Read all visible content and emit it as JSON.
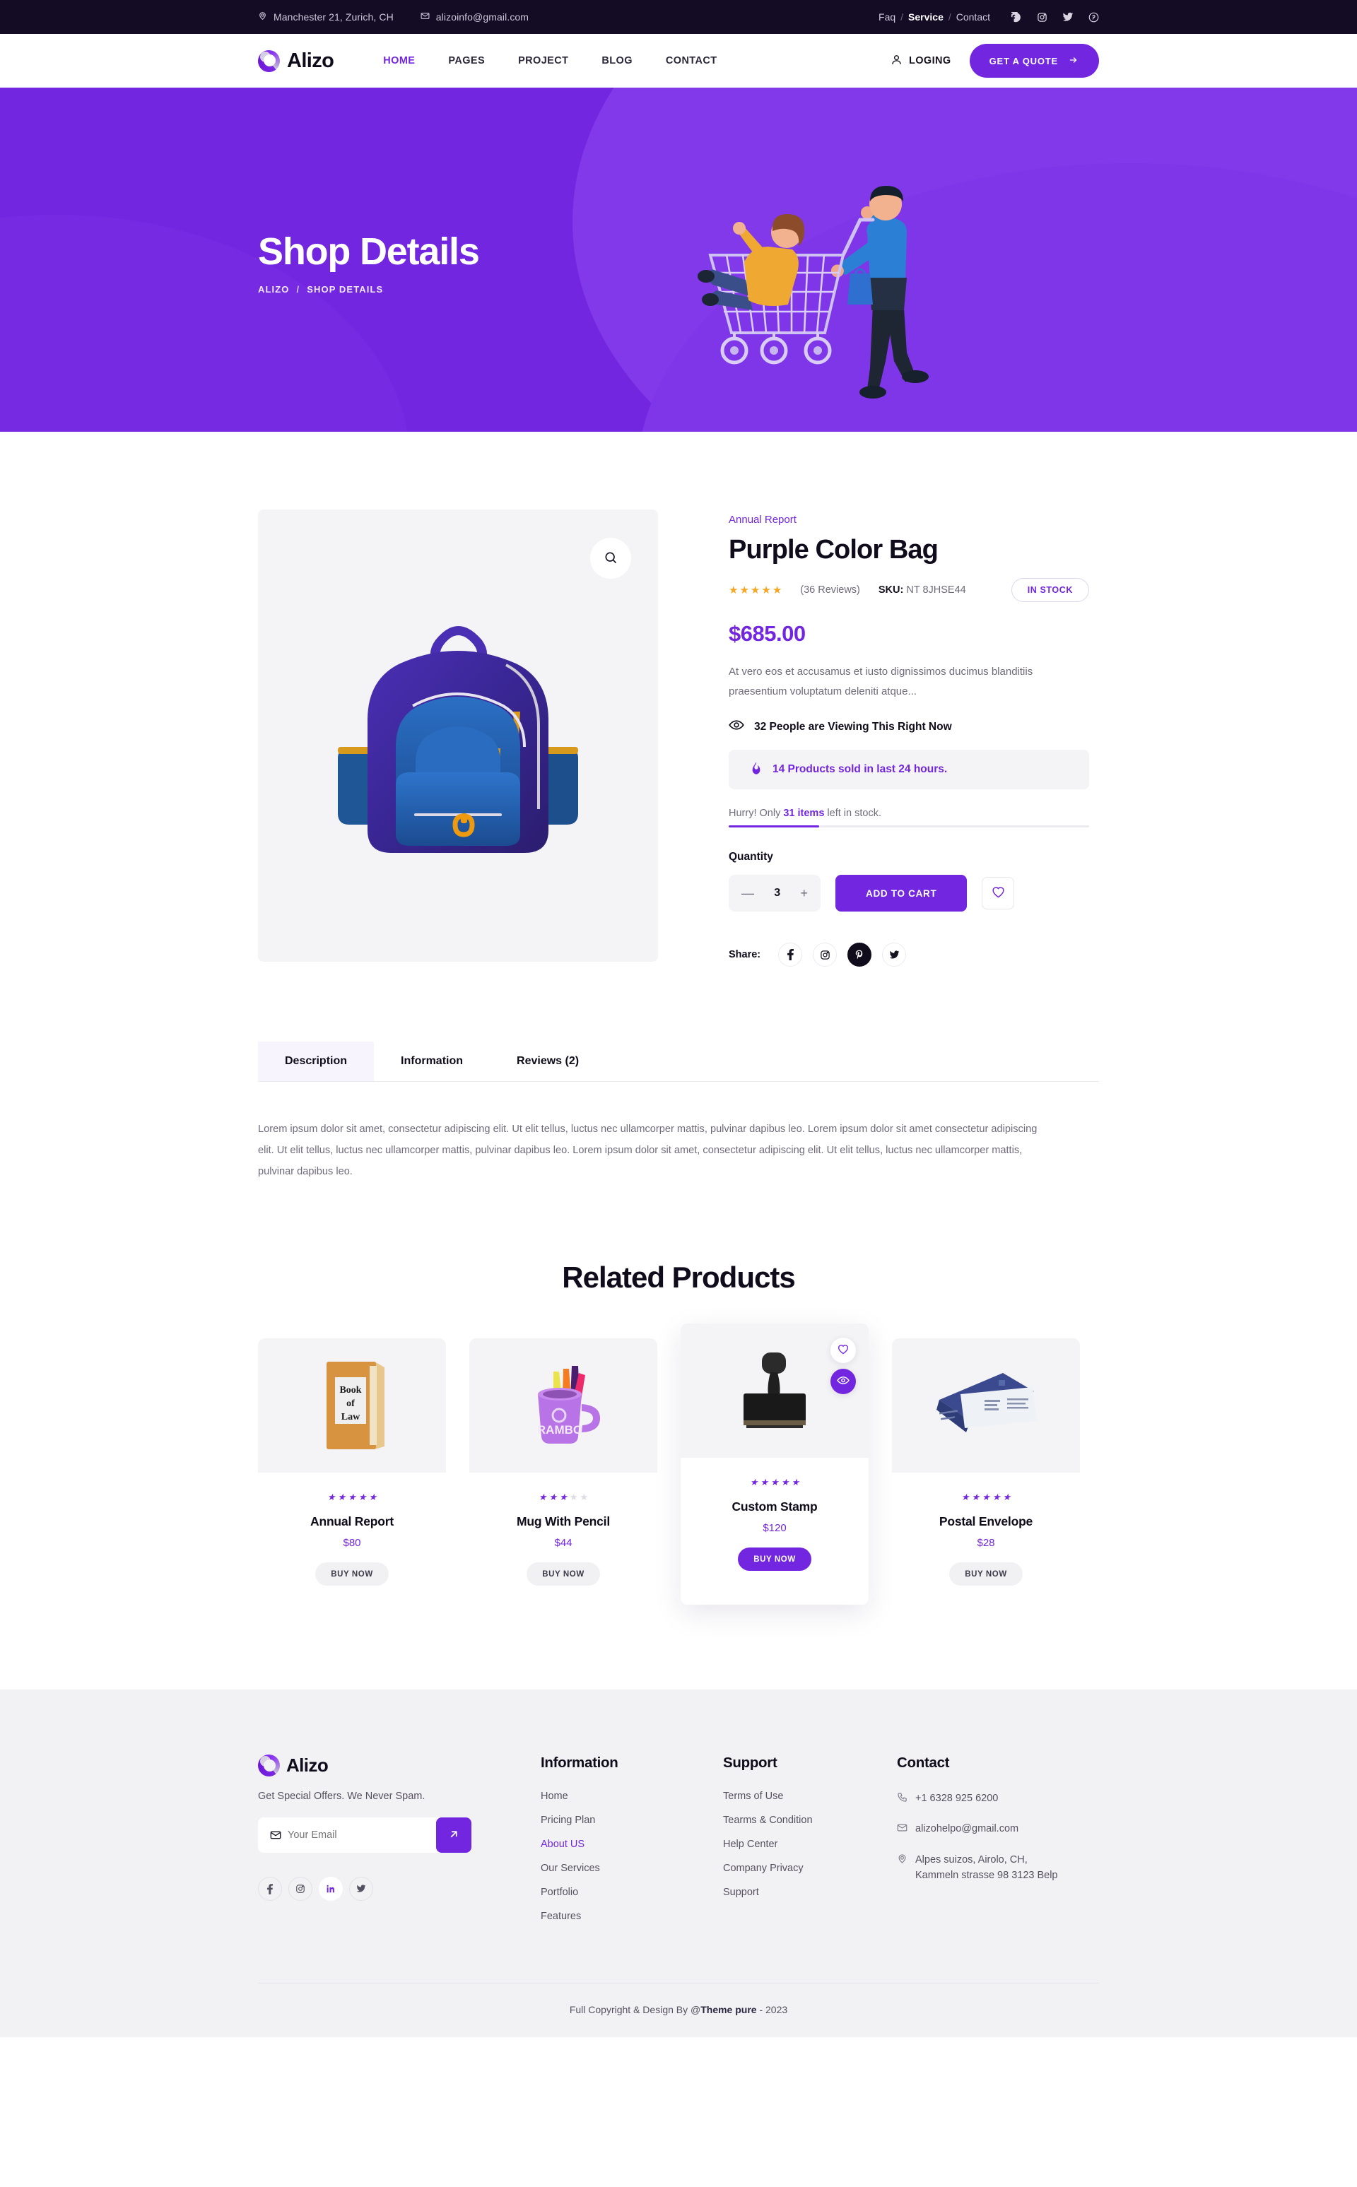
{
  "topbar": {
    "address": "Manchester 21, Zurich, CH",
    "email": "alizoinfo@gmail.com",
    "links": [
      {
        "label": "Faq",
        "active": false
      },
      {
        "label": "Service",
        "active": true
      },
      {
        "label": "Contact",
        "active": false
      }
    ],
    "separator": "/",
    "social": [
      "facebook-icon",
      "instagram-icon",
      "twitter-icon",
      "pinterest-icon"
    ]
  },
  "header": {
    "brand": "Alizo",
    "nav": [
      {
        "label": "HOME",
        "active": true
      },
      {
        "label": "PAGES",
        "active": false
      },
      {
        "label": "PROJECT",
        "active": false
      },
      {
        "label": "BLOG",
        "active": false
      },
      {
        "label": "CONTACT",
        "active": false
      }
    ],
    "login_label": "LOGING",
    "quote_label": "GET A QUOTE"
  },
  "hero": {
    "title": "Shop Details",
    "breadcrumb": [
      "ALIZO",
      "SHOP DETAILS"
    ],
    "breadcrumb_sep": "/"
  },
  "product": {
    "category": "Annual Report",
    "name": "Purple Color Bag",
    "rating": 5,
    "reviews_label": "(36 Reviews)",
    "sku_label": "SKU:",
    "sku_value": "NT 8JHSE44",
    "stock_badge": "IN STOCK",
    "price": "$685.00",
    "description": "At vero eos et accusamus et iusto dignissimos ducimus blanditiis praesentium voluptatum deleniti atque...",
    "viewing": "32 People are Viewing This Right Now",
    "sold": "14 Products sold in last 24 hours.",
    "hurry_pre": "Hurry! Only ",
    "hurry_items": "31 items",
    "hurry_post": " left in stock.",
    "stock_percent": 25,
    "quantity_label": "Quantity",
    "quantity_value": "3",
    "minus_label": "—",
    "plus_label": "+",
    "add_to_cart": "ADD TO CART",
    "share_label": "Share:",
    "share_icons": [
      "facebook-icon",
      "instagram-icon",
      "pinterest-icon",
      "twitter-icon"
    ]
  },
  "tabs": {
    "items": [
      {
        "label": "Description",
        "active": true
      },
      {
        "label": "Information",
        "active": false
      },
      {
        "label": "Reviews (2)",
        "active": false
      }
    ],
    "body": "Lorem ipsum dolor sit amet, consectetur adipiscing elit. Ut elit tellus, luctus nec ullamcorper mattis, pulvinar dapibus leo. Lorem ipsum dolor sit amet consectetur adipiscing elit. Ut elit tellus, luctus nec ullamcorper mattis, pulvinar dapibus leo. Lorem ipsum dolor sit amet, consectetur adipiscing elit. Ut elit tellus, luctus nec ullamcorper mattis, pulvinar dapibus leo."
  },
  "related": {
    "title": "Related Products",
    "buy_label": "BUY NOW",
    "products": [
      {
        "name": "Annual Report",
        "price": "$80",
        "rating": 5,
        "featured": false,
        "image": "law-book"
      },
      {
        "name": "Mug With Pencil",
        "price": "$44",
        "rating": 3,
        "featured": false,
        "image": "rambo-mug"
      },
      {
        "name": "Custom Stamp",
        "price": "$120",
        "rating": 5,
        "featured": true,
        "image": "rubber-stamp"
      },
      {
        "name": "Postal Envelope",
        "price": "$28",
        "rating": 5,
        "featured": false,
        "image": "envelope"
      }
    ]
  },
  "footer": {
    "brand": "Alizo",
    "tagline": "Get Special Offers. We Never Spam.",
    "email_placeholder": "Your Email",
    "email_value": "",
    "social": [
      "facebook-icon",
      "instagram-icon",
      "linkedin-icon",
      "twitter-icon"
    ],
    "information": {
      "title": "Information",
      "links": [
        {
          "label": "Home",
          "active": false
        },
        {
          "label": "Pricing Plan",
          "active": false
        },
        {
          "label": "About US",
          "active": true
        },
        {
          "label": "Our Services",
          "active": false
        },
        {
          "label": "Portfolio",
          "active": false
        },
        {
          "label": "Features",
          "active": false
        }
      ]
    },
    "support": {
      "title": "Support",
      "links": [
        {
          "label": "Terms of Use",
          "active": false
        },
        {
          "label": "Tearms & Condition",
          "active": false
        },
        {
          "label": "Help Center",
          "active": false
        },
        {
          "label": "Company Privacy",
          "active": false
        },
        {
          "label": "Support",
          "active": false
        }
      ]
    },
    "contact": {
      "title": "Contact",
      "phone": "+1 6328 925 6200",
      "email": "alizohelpo@gmail.com",
      "address": "Alpes suizos, Airolo, CH, Kammeln strasse 98 3123 Belp"
    },
    "copyright_pre": "Full Copyright & Design By @",
    "copyright_brand": "Theme pure",
    "copyright_post": " - 2023"
  },
  "colors": {
    "accent": "#7226e0",
    "dark": "#140b25",
    "star": "#f5a623",
    "light_bg": "#f4f4f6"
  }
}
